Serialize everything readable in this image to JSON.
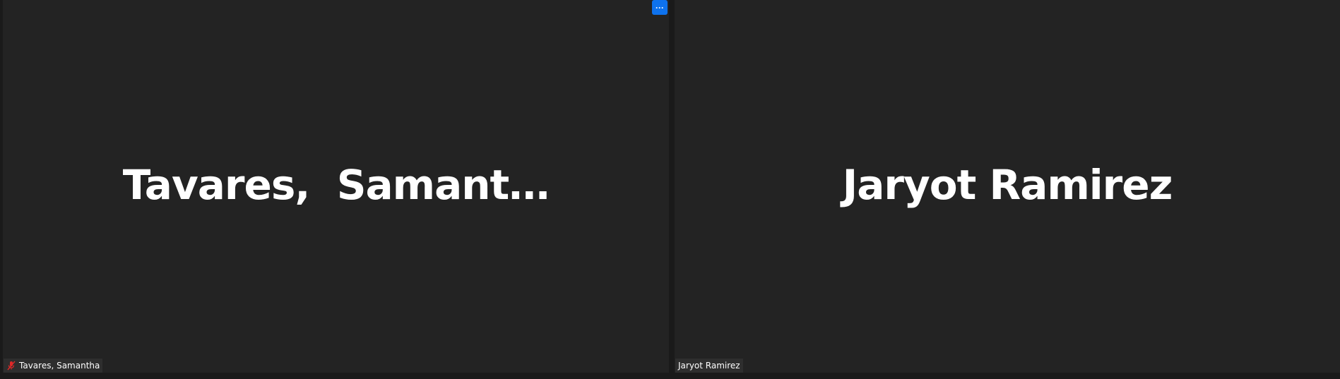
{
  "participants": [
    {
      "display_name": "Tavares,  Samant…",
      "label": "Tavares, Samantha",
      "muted": true,
      "mute_icon": "mic-muted-icon"
    },
    {
      "display_name": "Jaryot Ramirez",
      "label": "Jaryot Ramirez",
      "muted": false
    }
  ],
  "more_button": {
    "label": "···",
    "icon": "more-icon",
    "color": "#0e72ed"
  },
  "colors": {
    "tile_bg": "#232323",
    "page_bg": "#1a1a1a",
    "muted_icon": "#e02828"
  }
}
